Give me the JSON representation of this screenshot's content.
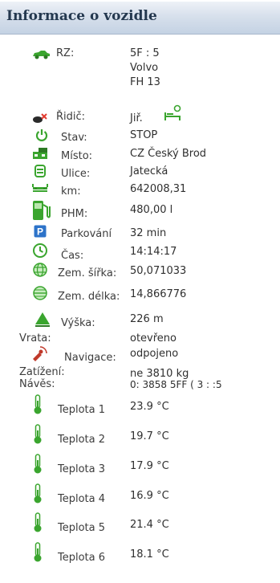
{
  "header": {
    "title": "Informace o vozidle"
  },
  "vehicle": {
    "rz_label": "RZ:",
    "rz_value": "5F  :  5",
    "make": "Volvo",
    "model": "FH 13"
  },
  "rows": {
    "ridic": {
      "label": "Řidič:",
      "value": "Jiř."
    },
    "stav": {
      "label": "Stav:",
      "value": "STOP"
    },
    "misto": {
      "label": "Místo:",
      "value": "CZ Český Brod"
    },
    "ulice": {
      "label": "Ulice:",
      "value": "Jatecká"
    },
    "km": {
      "label": "km:",
      "value": "642008,31"
    },
    "phm": {
      "label": "PHM:",
      "value": "480,00 l"
    },
    "parkovani": {
      "label": "Parkování",
      "value": "32 min"
    },
    "cas": {
      "label": "Čas:",
      "value": "14:14:17"
    },
    "sirka": {
      "label": "Zem. šířka:",
      "value": "50,071033"
    },
    "delka": {
      "label": "Zem. délka:",
      "value": "14,866776"
    },
    "vyska": {
      "label": "Výška:",
      "value": "226 m"
    },
    "vrata": {
      "label": "Vrata:",
      "value": "otevřeno"
    },
    "navigace": {
      "label": "Navigace:",
      "value": "odpojeno"
    },
    "zatizeni": {
      "label": "Zatížení:",
      "value": "ne 3810 kg"
    },
    "naves": {
      "label": "Návěs:",
      "value": "0:  3858  5FF (  3 :  :5"
    }
  },
  "temperatures": [
    {
      "label": "Teplota 1",
      "value": "23.9 °C"
    },
    {
      "label": "Teplota 2",
      "value": "19.7 °C"
    },
    {
      "label": "Teplota 3",
      "value": "17.9 °C"
    },
    {
      "label": "Teplota 4",
      "value": "16.9 °C"
    },
    {
      "label": "Teplota 5",
      "value": "21.4 °C"
    },
    {
      "label": "Teplota 6",
      "value": "18.1 °C"
    }
  ],
  "icons": {
    "rz": "car-icon",
    "ridic": "driver-icon",
    "driver_status": "driver-resting-icon",
    "stav": "power-icon",
    "misto": "place-icon",
    "ulice": "street-icon",
    "km": "odometer-icon",
    "phm": "fuel-pump-icon",
    "parkovani": "parking-icon",
    "cas": "clock-icon",
    "sirka": "globe-latitude-icon",
    "delka": "globe-longitude-icon",
    "vyska": "altitude-icon",
    "navigace": "satellite-icon",
    "teplota": "thermometer-icon"
  },
  "colors": {
    "header_top": "#eef2f7",
    "header_bottom": "#c4d2e3",
    "header_text": "#24384f",
    "icon_green": "#3aa52e",
    "parking_blue": "#2d73c9"
  }
}
